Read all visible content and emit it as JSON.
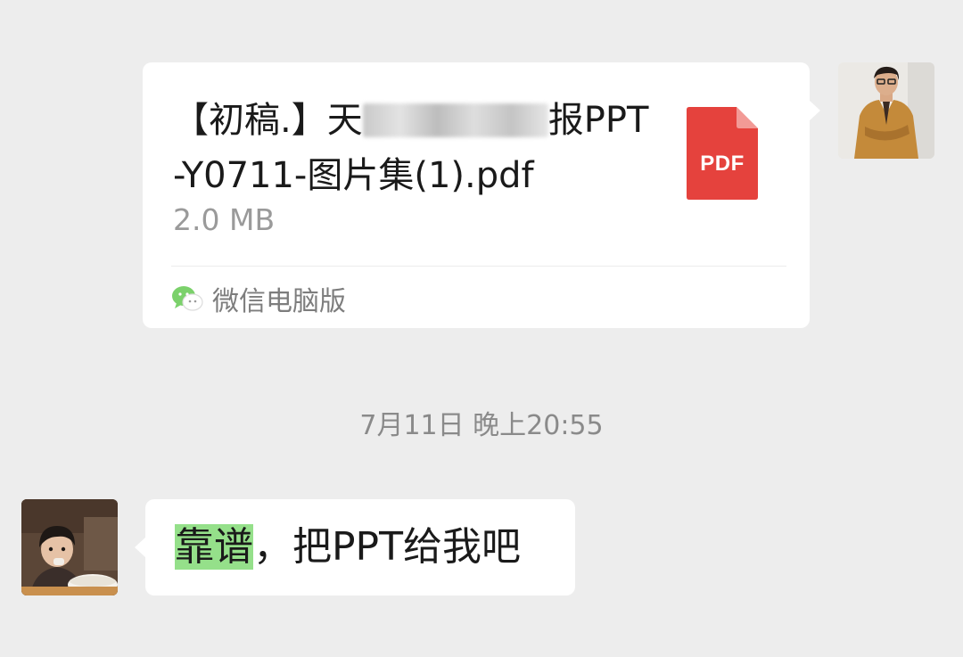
{
  "file_message": {
    "title_prefix": "【初稿.】天",
    "title_suffix": "报",
    "title_line2": "PPT-Y0711-图片集(1).pdf",
    "size": "2.0 MB",
    "file_type_label": "PDF",
    "source": "微信电脑版",
    "icon": "pdf-file-icon",
    "source_icon": "wechat-icon"
  },
  "timestamp": "7月11日 晚上20:55",
  "text_message": {
    "highlighted": "靠谱",
    "rest": "，把PPT给我吧",
    "highlight_color": "#95e08a"
  },
  "colors": {
    "background": "#ededed",
    "bubble": "#ffffff",
    "pdf_red": "#e5423d",
    "wechat_green": "#7bd16b"
  }
}
